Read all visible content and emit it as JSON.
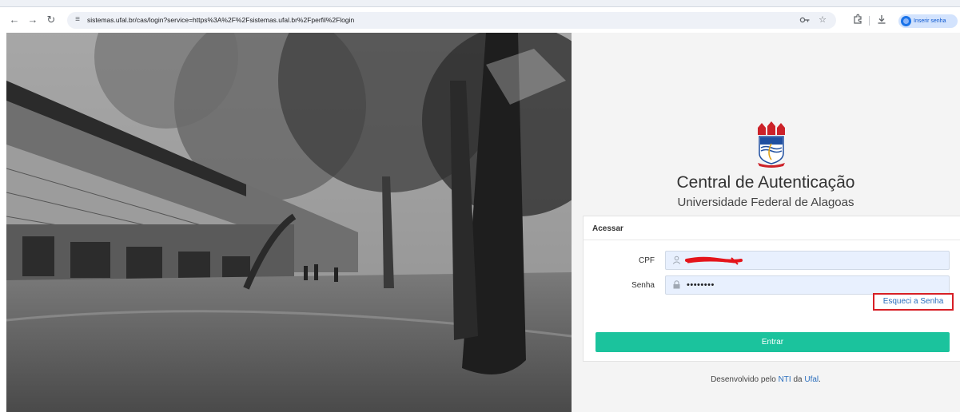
{
  "browser": {
    "url": "sistemas.ufal.br/cas/login?service=https%3A%2F%2Fsistemas.ufal.br%2Fperfil%2Flogin",
    "profile_label": "Inserir senha",
    "icons": {
      "back": "arrow-left",
      "forward": "arrow-right",
      "reload": "reload",
      "site_info": "tune",
      "password_key": "key",
      "bookmark": "star",
      "extensions": "puzzle",
      "downloads": "download",
      "tab_search": "playlist",
      "profile": "avatar"
    }
  },
  "photo": {
    "description": "Black and white photograph of university campus with trees and building"
  },
  "brand": {
    "title": "Central de Autenticação",
    "subtitle": "Universidade Federal de Alagoas",
    "colors": {
      "accent": "#1bc39d",
      "link": "#2a6ebd",
      "highlight_border": "#d71f26"
    }
  },
  "login": {
    "header": "Acessar",
    "cpf_label": "CPF",
    "cpf_value": "",
    "password_label": "Senha",
    "password_value": "••••••••",
    "forgot_label": "Esqueci a Senha",
    "submit_label": "Entrar"
  },
  "footer": {
    "prefix": "Desenvolvido pelo",
    "nti_link": "NTI",
    "middle": "da",
    "ufal_link": "Ufal",
    "suffix": "."
  }
}
